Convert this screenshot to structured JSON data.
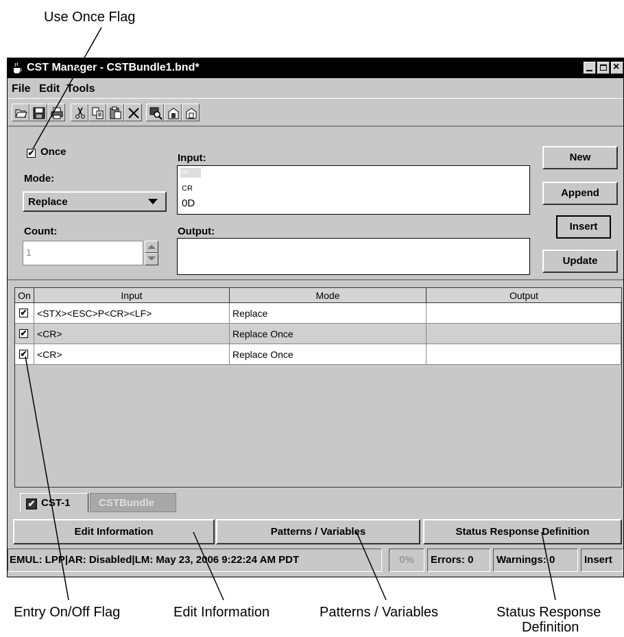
{
  "callouts": {
    "use_once_flag": "Use Once Flag",
    "entry_on_off_flag": "Entry On/Off Flag",
    "edit_information": "Edit Information",
    "patterns_variables": "Patterns / Variables",
    "status_response_line1": "Status Response",
    "status_response_line2": "Definition"
  },
  "window": {
    "title": "CST Manager - CSTBundle1.bnd*",
    "menu": {
      "file": "File",
      "edit": "Edit",
      "tools": "Tools"
    }
  },
  "toolbar": {
    "icons": [
      "open-icon",
      "save-icon",
      "print-icon",
      "cut-icon",
      "copy-icon",
      "paste-icon",
      "delete-icon",
      "search-icon",
      "import-icon",
      "export-icon"
    ]
  },
  "editor": {
    "once_label": "Once",
    "once_checked": true,
    "mode_label": "Mode:",
    "mode_value": "Replace",
    "count_label": "Count:",
    "count_value": "1",
    "input_label": "Input:",
    "input_lines": [
      "m",
      "CR",
      "0D"
    ],
    "output_label": "Output:",
    "output_value": "",
    "buttons": {
      "new": "New",
      "append": "Append",
      "insert": "Insert",
      "update": "Update"
    }
  },
  "table": {
    "headers": {
      "on": "On",
      "input": "Input",
      "mode": "Mode",
      "output": "Output"
    },
    "rows": [
      {
        "on": true,
        "input": "<STX><ESC>P<CR><LF>",
        "mode": "Replace",
        "output": ""
      },
      {
        "on": true,
        "input": "<CR>",
        "mode": "Replace Once",
        "output": ""
      },
      {
        "on": true,
        "input": "<CR>",
        "mode": "Replace Once",
        "output": ""
      }
    ]
  },
  "tabs": {
    "active": "CST-1",
    "inactive": "CSTBundle"
  },
  "bottom_buttons": {
    "edit_information": "Edit Information",
    "patterns_variables": "Patterns / Variables",
    "status_response": "Status Response Definition"
  },
  "statusbar": {
    "info": "EMUL: LPP|AR: Disabled|LM: May 23, 2006 9:22:24 AM PDT",
    "progress": "0%",
    "errors": "Errors: 0",
    "warnings": "Warnings: 0",
    "mode": "Insert"
  }
}
